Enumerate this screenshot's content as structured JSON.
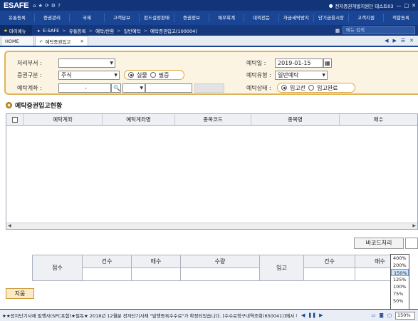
{
  "app": {
    "logo": "ESAFE",
    "user": "전자증권개발지원단 테스트03"
  },
  "menu": [
    "유통등록",
    "증권관리",
    "국제",
    "고객담보",
    "펀드설정판매",
    "증권정보",
    "채무회계",
    "대외전문",
    "자금세탁방지",
    "단기금융시장",
    "고객지원",
    "적합등록"
  ],
  "crumb": {
    "favorites": "마이메뉴",
    "items": [
      "E-SAFE",
      "유통등록",
      "예탁/반환",
      "일반예탁",
      "예탁증권입고(100004)"
    ],
    "search_placeholder": "메뉴 검색"
  },
  "tabs": {
    "home": "HOME",
    "active": "예탁증권입고"
  },
  "filter": {
    "dept_label": "처리부서 :",
    "dept_value": "",
    "sectype_label": "증권구분 :",
    "sectype_value": "주식",
    "radio_real": "실물",
    "radio_cert": "필증",
    "account_label": "예탁계좌 :",
    "account_value": "-",
    "date_label": "예탁일 :",
    "date_value": "2019-01-15",
    "deptype_label": "예탁유형 :",
    "deptype_value": "일반예탁",
    "status_label": "예탁상태 :",
    "status_before": "입고전",
    "status_done": "입고완료"
  },
  "section": {
    "title": "예탁증권입고현황"
  },
  "grid": {
    "columns": [
      "예탁계좌",
      "예탁계좌명",
      "종목코드",
      "종목명",
      "매수"
    ]
  },
  "barcode": {
    "label": "바코드처리"
  },
  "summary": {
    "left_label": "접수",
    "right_label": "입고",
    "cols": [
      "건수",
      "매수",
      "수량"
    ],
    "right_cols": [
      "건수",
      "매수"
    ]
  },
  "zoom": {
    "options": [
      "400%",
      "200%",
      "150%",
      "125%",
      "100%",
      "75%",
      "50%"
    ],
    "selected": "150%"
  },
  "buttons": {
    "delete": "지움"
  },
  "ticker": {
    "text": "★★전자단기사채 발행사(SPC포함)★필독★ 2018년 12월분 전자단기사채 \"발행등록수수료\"가 확정되었습니다. [수수료청구내역조회(650041)]에서 확인하신..."
  }
}
